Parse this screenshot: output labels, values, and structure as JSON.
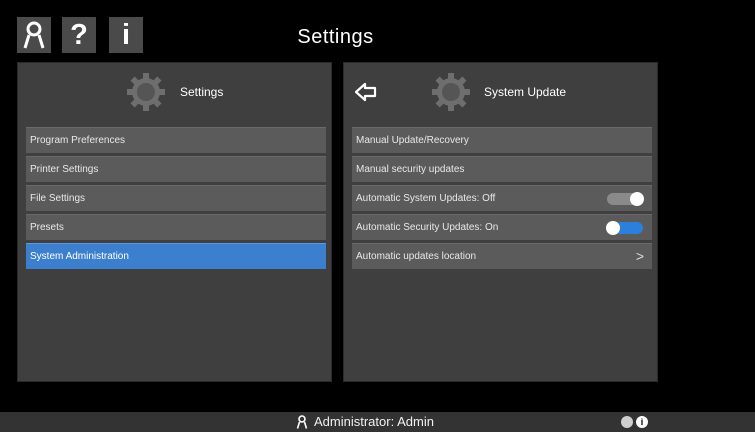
{
  "app": {
    "title": "Settings"
  },
  "toolbar": {
    "user_icon": "user-icon",
    "help_label": "?",
    "info_label": "i"
  },
  "left_panel": {
    "title": "Settings",
    "icon": "gear-icon",
    "items": [
      {
        "label": "Program Preferences",
        "selected": false
      },
      {
        "label": "Printer Settings",
        "selected": false
      },
      {
        "label": "File Settings",
        "selected": false
      },
      {
        "label": "Presets",
        "selected": false
      },
      {
        "label": "System Administration",
        "selected": true
      }
    ]
  },
  "right_panel": {
    "title": "System Update",
    "icon": "gear-icon",
    "back_icon": "back-arrow-icon",
    "items": [
      {
        "label": "Manual Update/Recovery",
        "control": "none"
      },
      {
        "label": "Manual security updates",
        "control": "none"
      },
      {
        "label": "Automatic System Updates: Off",
        "control": "toggle",
        "state": "off"
      },
      {
        "label": "Automatic Security Updates: On",
        "control": "toggle",
        "state": "on"
      },
      {
        "label": "Automatic updates location",
        "control": "chevron",
        "chevron": ">"
      }
    ]
  },
  "status_bar": {
    "left_text": "",
    "user_text": "Administrator: Admin",
    "info_label": "i",
    "right_text": ""
  },
  "colors": {
    "accent": "#3c7fcf",
    "panel_bg": "#3f3f3f",
    "row_bg": "#5b5b5b",
    "toggle_on": "#2d7fdc",
    "toggle_off": "#8a8a8a",
    "status_red": "#d02020"
  }
}
